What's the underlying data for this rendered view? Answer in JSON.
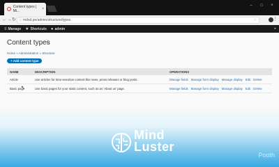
{
  "browser": {
    "tab_title": "Content types | Mi...",
    "tab_close": "×",
    "url": "mdsd.pe/admin/structure/types",
    "window_controls": [
      "–",
      "□",
      "×"
    ],
    "nav_icons": [
      "arrow-left-icon",
      "arrow-right-icon",
      "reload-icon"
    ]
  },
  "toolbar": {
    "manage": "Manage",
    "shortcuts": "Shortcuts",
    "user": "admin",
    "right": "▸"
  },
  "page": {
    "title": "Content types",
    "breadcrumb": "Home » Administration » Structure",
    "add_button": "+ Add content type"
  },
  "table": {
    "headers": [
      "NAME",
      "DESCRIPTION",
      "OPERATIONS"
    ],
    "rows": [
      {
        "name": "Article",
        "description": "Use articles for time-sensitive content like news, press releases or blog posts.",
        "ops": [
          "Manage fields",
          "Manage form display",
          "Manage display",
          "Edit",
          "Delete"
        ]
      },
      {
        "name": "Basic page",
        "description": "Use basic pages for your static content, such as an 'About us' page.",
        "ops": [
          "Manage fields",
          "Manage form display",
          "Manage display",
          "Edit",
          "Delete"
        ]
      }
    ]
  },
  "overlay": {
    "logo_line1": "Mind",
    "logo_line2": "Luster",
    "watermark": "Pooth"
  },
  "colors": {
    "accent": "#0071b8",
    "link": "#2a6db0",
    "overlay": "#2da5e1"
  }
}
